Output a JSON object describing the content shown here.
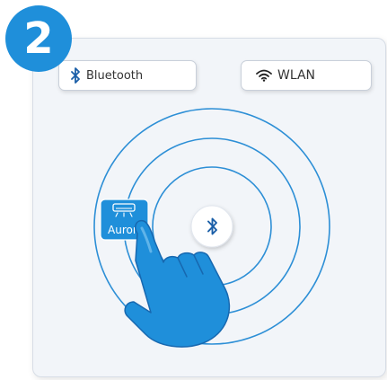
{
  "step": {
    "number": "2"
  },
  "chips": {
    "bluetooth": {
      "label": "Bluetooth",
      "icon": "bluetooth-icon"
    },
    "wlan": {
      "label": "WLAN",
      "icon": "wifi-icon"
    }
  },
  "device": {
    "label": "Aurora",
    "icon": "air-conditioner-icon"
  },
  "center": {
    "icon": "bluetooth-icon"
  },
  "colors": {
    "accent": "#1f8fda",
    "ring": "#2d8fd6",
    "card_bg": "#f2f5f9",
    "hand": "#1f8fda"
  }
}
